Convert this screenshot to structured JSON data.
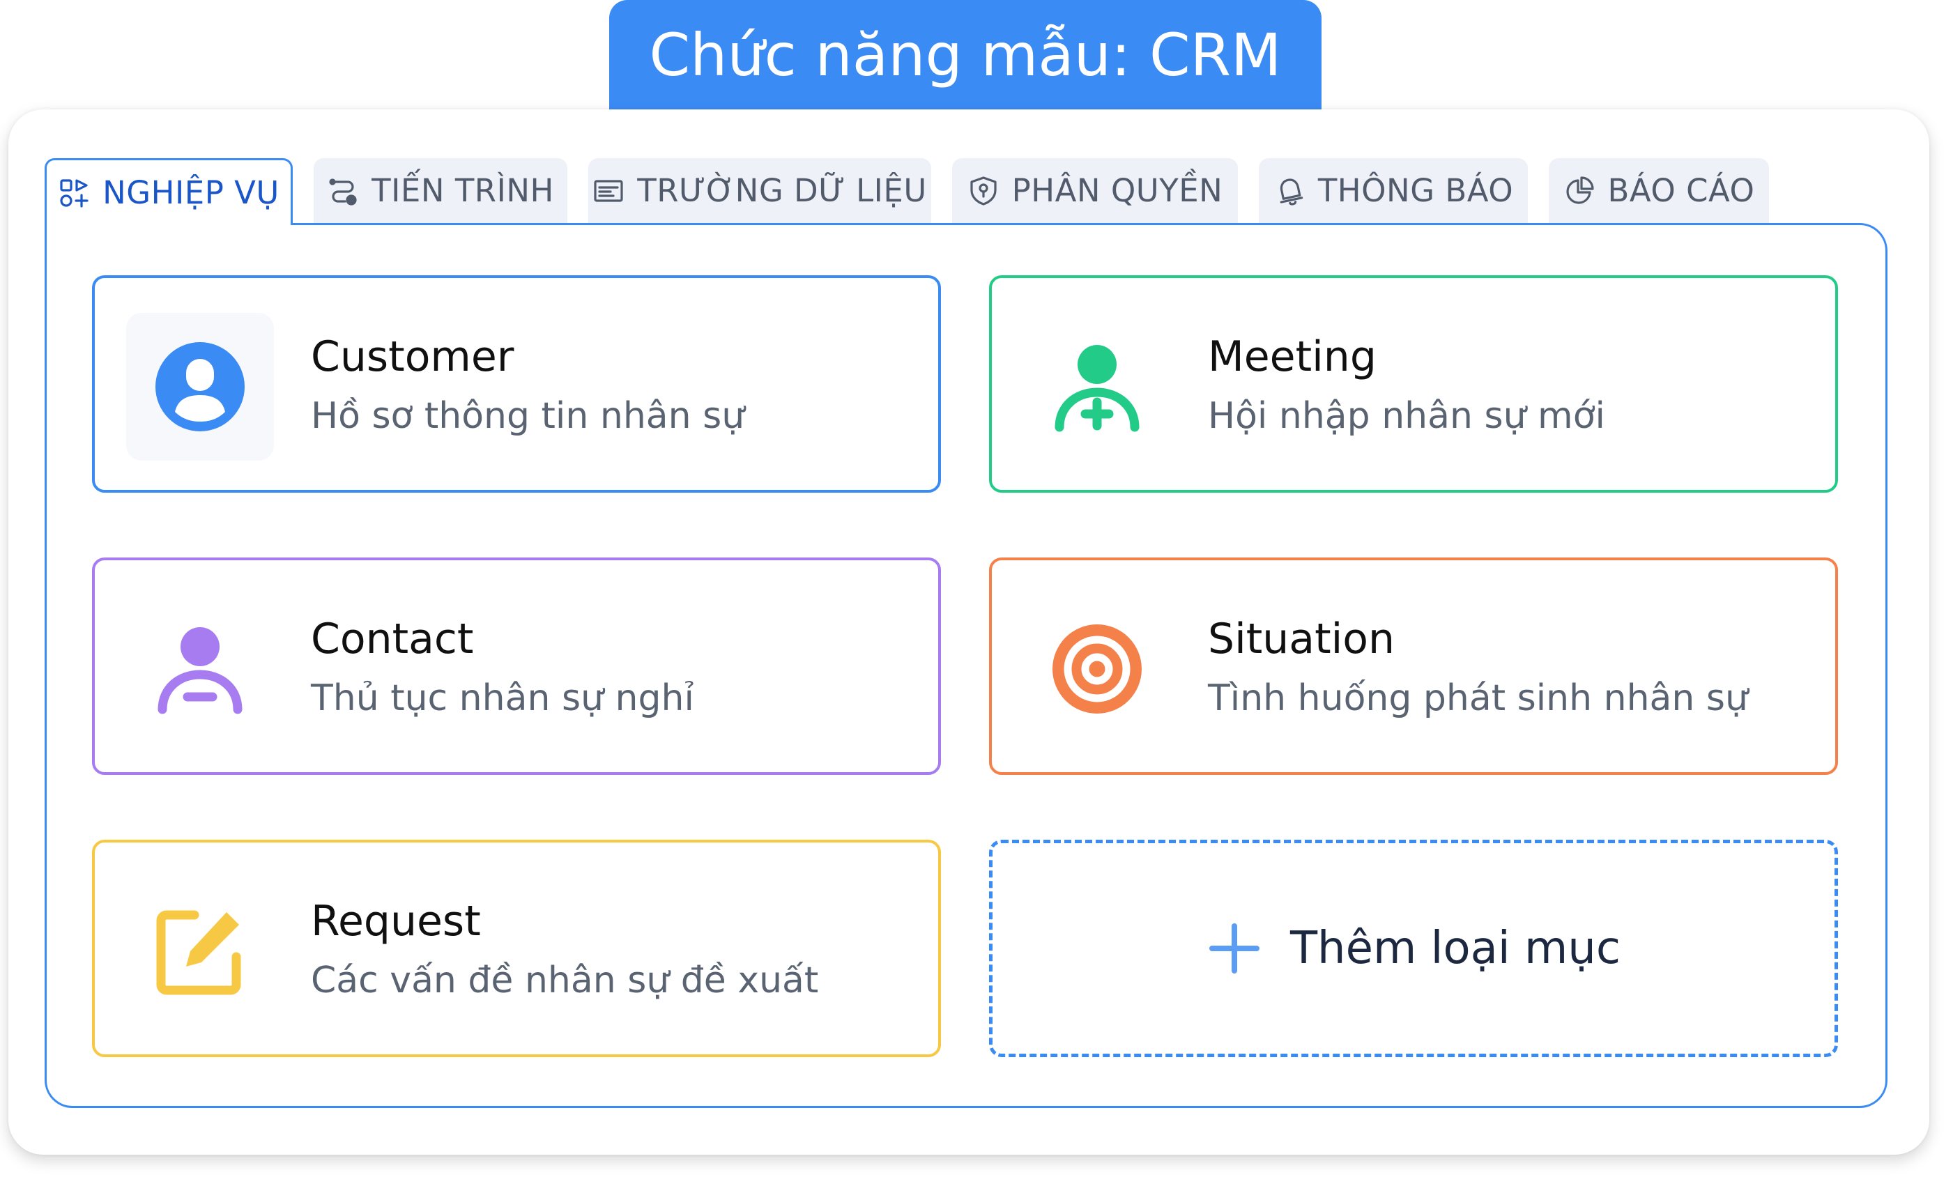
{
  "title": "Chức năng mẫu: CRM",
  "tabs": [
    {
      "label": "NGHIỆP VỤ",
      "icon": "grid-plus-icon",
      "active": true
    },
    {
      "label": "TIẾN TRÌNH",
      "icon": "workflow-icon",
      "active": false
    },
    {
      "label": "TRƯỜNG DỮ LIỆU",
      "icon": "form-field-icon",
      "active": false
    },
    {
      "label": "PHÂN QUYỀN",
      "icon": "shield-icon",
      "active": false
    },
    {
      "label": "THÔNG BÁO",
      "icon": "bell-icon",
      "active": false
    },
    {
      "label": "BÁO CÁO",
      "icon": "pie-chart-icon",
      "active": false
    }
  ],
  "cards": [
    {
      "name": "Customer",
      "desc": "Hồ sơ thông tin nhân sự",
      "color": "#3b8bf5",
      "icon": "user-circle-icon"
    },
    {
      "name": "Meeting",
      "desc": "Hội nhập nhân sự mới",
      "color": "#22cc88",
      "icon": "user-add-icon"
    },
    {
      "name": "Contact",
      "desc": "Thủ tục nhân sự nghỉ",
      "color": "#a77cf0",
      "icon": "user-remove-icon"
    },
    {
      "name": "Situation",
      "desc": "Tình huống phát sinh nhân sự",
      "color": "#f5814a",
      "icon": "target-icon"
    },
    {
      "name": "Request",
      "desc": "Các vấn đề nhân sự đề xuất",
      "color": "#f7c843",
      "icon": "edit-icon"
    }
  ],
  "add_card": {
    "label": "Thêm loại mục",
    "icon": "plus-icon"
  },
  "colors": {
    "accent": "#3b8bf5"
  }
}
